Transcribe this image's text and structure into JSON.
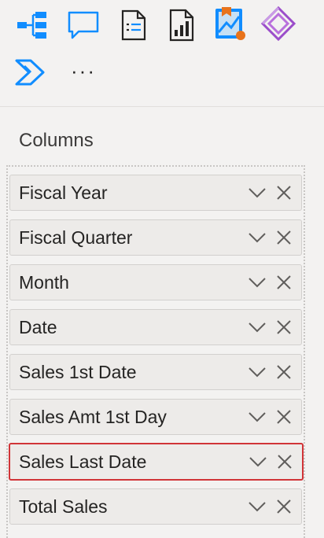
{
  "toolbar": {
    "icons": [
      "decomposition-tree-icon",
      "comment-icon",
      "paginated-report-icon",
      "report-chart-icon",
      "metrics-icon",
      "power-apps-icon",
      "power-automate-icon",
      "more-options-icon"
    ],
    "more_label": "···"
  },
  "columns_section": {
    "title": "Columns",
    "fields": [
      {
        "label": "Fiscal Year",
        "selected": false
      },
      {
        "label": "Fiscal Quarter",
        "selected": false
      },
      {
        "label": "Month",
        "selected": false
      },
      {
        "label": "Date",
        "selected": false
      },
      {
        "label": "Sales 1st Date",
        "selected": false
      },
      {
        "label": "Sales Amt 1st Day",
        "selected": false
      },
      {
        "label": "Sales Last Date",
        "selected": true
      },
      {
        "label": "Total Sales",
        "selected": false
      }
    ]
  },
  "colors": {
    "accent_blue": "#118dff",
    "selection_red": "#d13438",
    "power_apps_purple": "#9b4dca",
    "metrics_orange": "#e8731b"
  }
}
